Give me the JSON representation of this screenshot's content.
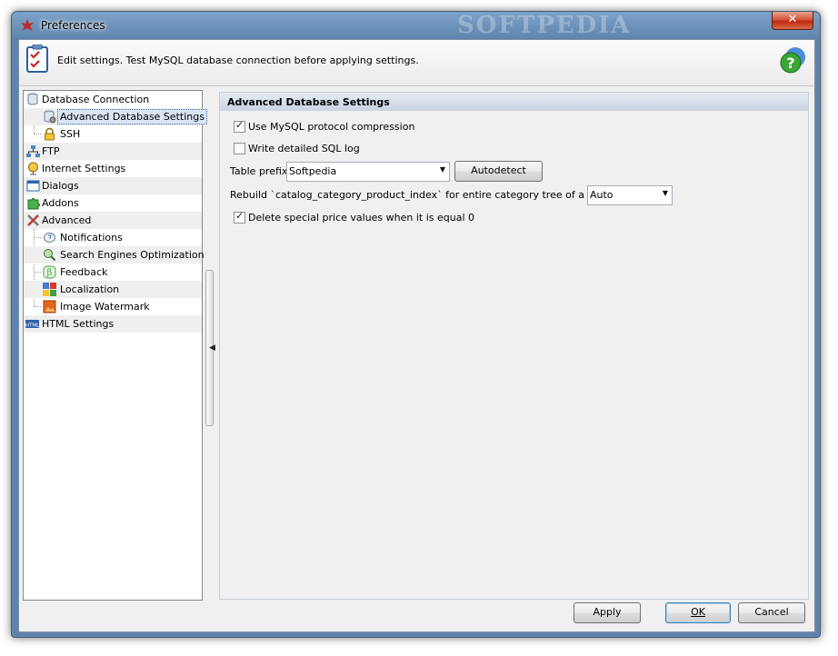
{
  "window": {
    "title": "Preferences",
    "close_glyph": "✕",
    "watermark": "SOFTPEDIA"
  },
  "header": {
    "text": "Edit settings. Test MySQL database connection before applying settings.",
    "icon": "checklist-icon",
    "help_icon": "help-icon"
  },
  "tree": {
    "items": [
      {
        "label": "Database Connection",
        "icon": "database-icon"
      },
      {
        "label": "Advanced Database Settings",
        "icon": "database-settings-icon"
      },
      {
        "label": "SSH",
        "icon": "lock-icon"
      },
      {
        "label": "FTP",
        "icon": "network-icon"
      },
      {
        "label": "Internet Settings",
        "icon": "globe-icon"
      },
      {
        "label": "Dialogs",
        "icon": "dialog-window-icon"
      },
      {
        "label": "Addons",
        "icon": "puzzle-icon"
      },
      {
        "label": "Advanced",
        "icon": "tools-icon"
      },
      {
        "label": "Notifications",
        "icon": "notification-icon"
      },
      {
        "label": "Search Engines Optimization",
        "icon": "seo-icon"
      },
      {
        "label": "Feedback",
        "icon": "feedback-icon"
      },
      {
        "label": "Localization",
        "icon": "localization-icon"
      },
      {
        "label": "Image Watermark",
        "icon": "image-icon"
      },
      {
        "label": "HTML Settings",
        "icon": "html-icon"
      }
    ],
    "selected": "Advanced Database Settings"
  },
  "panel": {
    "title": "Advanced Database Settings",
    "compression": {
      "label": "Use MySQL protocol compression",
      "checked": true
    },
    "sql_log": {
      "label": "Write detailed SQL log",
      "checked": false
    },
    "table_prefix": {
      "label": "Table prefix",
      "value": "Softpedia"
    },
    "autodetect_label": "Autodetect",
    "rebuild": {
      "label": "Rebuild `catalog_category_product_index` for entire category tree of a product",
      "value": "Auto"
    },
    "delete_special": {
      "label": "Delete special price values when it is equal 0",
      "checked": true
    }
  },
  "buttons": {
    "apply": "Apply",
    "ok": "OK",
    "cancel": "Cancel"
  },
  "colors": {
    "title_bar": "#5e84ad",
    "selection": "#dbe6f4",
    "panel_header": "#c9d4e1"
  }
}
